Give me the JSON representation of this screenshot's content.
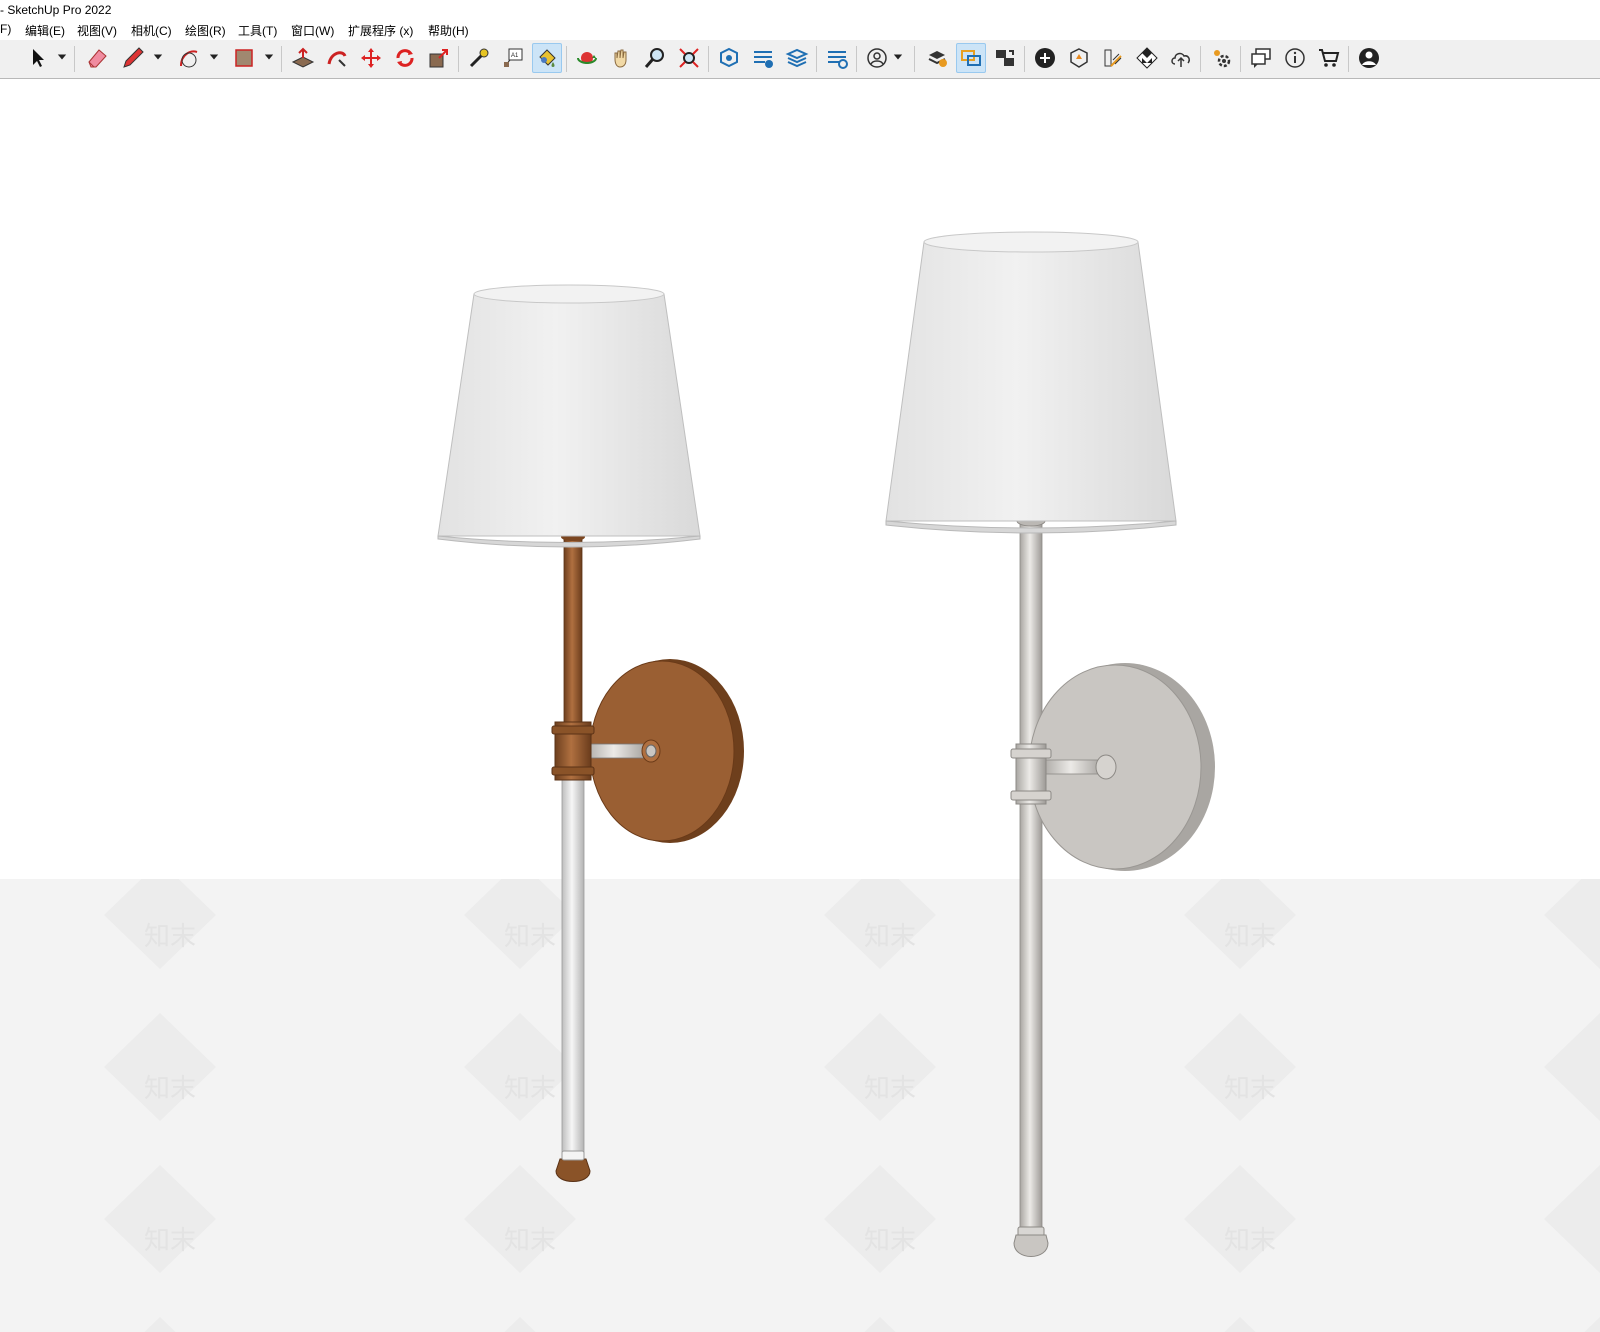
{
  "window": {
    "title": "- SketchUp Pro 2022"
  },
  "menu": {
    "items": [
      {
        "label": "F)"
      },
      {
        "label": "编辑(E)"
      },
      {
        "label": "视图(V)"
      },
      {
        "label": "相机(C)"
      },
      {
        "label": "绘图(R)"
      },
      {
        "label": "工具(T)"
      },
      {
        "label": "窗口(W)"
      },
      {
        "label": "扩展程序 (x)"
      },
      {
        "label": "帮助(H)"
      }
    ]
  },
  "toolbar": {
    "tools": [
      "select-icon",
      "eraser-icon",
      "pencil-line-icon",
      "arc-icon",
      "rectangle-icon",
      "push-pull-icon",
      "follow-me-icon",
      "move-icon",
      "rotate-icon",
      "scale-icon",
      "tape-measure-icon",
      "text-label-icon",
      "paint-bucket-icon",
      "orbit-icon",
      "pan-hand-icon",
      "zoom-icon",
      "zoom-extents-icon",
      "warehouse-icon",
      "extension-warehouse-icon",
      "layout-icon",
      "extension-manager-icon",
      "account-icon",
      "trimble-connect-icon",
      "sync-icon",
      "layer-flip-icon",
      "add-location-icon",
      "sandbox-icon",
      "solar-north-icon",
      "checker-icon",
      "cloud-upload-icon",
      "settings-gears-icon",
      "comment-icon",
      "info-icon",
      "cart-icon",
      "user-profile-icon"
    ],
    "active_tools": [
      "paint-bucket-icon",
      "sync-icon"
    ]
  },
  "viewport": {
    "ground_color": "#f3f3f3",
    "sky_color": "#ffffff",
    "watermark_text": "知末",
    "models": [
      {
        "name": "bronze-wall-sconce",
        "finish_color": "#9a5f33",
        "shade_color": "#ececec"
      },
      {
        "name": "silver-wall-sconce",
        "finish_color": "#c9c6c2",
        "shade_color": "#ececec"
      }
    ]
  }
}
